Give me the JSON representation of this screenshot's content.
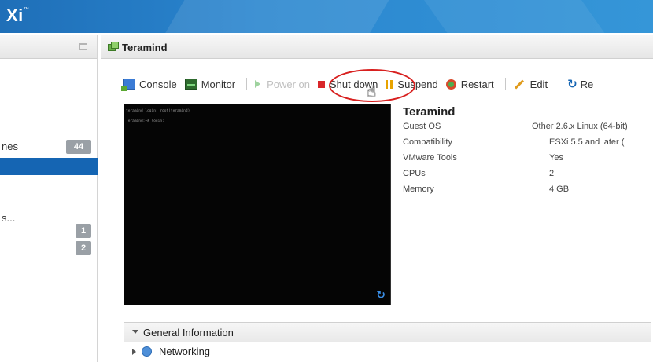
{
  "app": {
    "title": "Xi",
    "title_mark": "™"
  },
  "navigator": {
    "rows": [
      {
        "label": "nes",
        "badge": "44"
      },
      {
        "label": "s...",
        "badge": ""
      },
      {
        "label": "",
        "badge": "1"
      },
      {
        "label": "",
        "badge": "2"
      }
    ]
  },
  "vm_panel": {
    "title": "Teramind",
    "toolbar": {
      "console": "Console",
      "monitor": "Monitor",
      "power_on": "Power on",
      "shut_down": "Shut down",
      "suspend": "Suspend",
      "restart": "Restart",
      "edit": "Edit",
      "refresh": "Re"
    },
    "console_preview": {
      "lines": [
        "teramind login: root(teramind)",
        "Teramind:~# login: _"
      ]
    },
    "vm_name": "Teramind",
    "details": [
      {
        "label": "Guest OS",
        "value": "Other 2.6.x Linux (64-bit)"
      },
      {
        "label": "Compatibility",
        "value": "ESXi 5.5 and later ("
      },
      {
        "label": "VMware Tools",
        "value": "Yes"
      },
      {
        "label": "CPUs",
        "value": "2"
      },
      {
        "label": "Memory",
        "value": "4 GB"
      }
    ],
    "sections": {
      "general_information": "General Information",
      "networking": "Networking"
    }
  },
  "colors": {
    "topbar": "#2a86cf",
    "selection": "#1565b3",
    "highlight": "#d8201f"
  }
}
